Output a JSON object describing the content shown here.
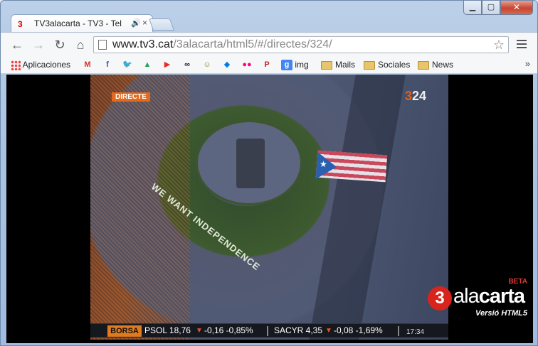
{
  "window": {
    "controls": {
      "minimize": "▁",
      "maximize": "▢",
      "close": "✕"
    }
  },
  "tab": {
    "favicon": "3",
    "title": "TV3alacarta - TV3 - Tel",
    "audio_icon": "speaker-icon",
    "audio_glyph": "🔊",
    "close_glyph": "×"
  },
  "toolbar": {
    "back": "←",
    "forward": "→",
    "reload": "↻",
    "home": "⌂",
    "url_host": "www.tv3.cat",
    "url_rest": "/3alacarta/html5/#/directes/324/",
    "star": "☆"
  },
  "bookmarks": {
    "apps_label": "Aplicaciones",
    "items": [
      {
        "icon": "gmail-icon",
        "glyph": "M",
        "color": "#d93025"
      },
      {
        "icon": "facebook-icon",
        "glyph": "f",
        "color": "#3b5998"
      },
      {
        "icon": "twitter-icon",
        "glyph": "🐦",
        "color": "#1da1f2"
      },
      {
        "icon": "drive-icon",
        "glyph": "▲",
        "color": "#1ea362"
      },
      {
        "icon": "youtube-icon",
        "glyph": "▶",
        "color": "#e52d27"
      },
      {
        "icon": "infinity-icon",
        "glyph": "∞",
        "color": "#222222"
      },
      {
        "icon": "smiley-icon",
        "glyph": "☺",
        "color": "#8a8a30"
      },
      {
        "icon": "dropbox-icon",
        "glyph": "◆",
        "color": "#007ee5"
      },
      {
        "icon": "flickr-icon",
        "glyph": "●●",
        "color": "#ff0084"
      },
      {
        "icon": "pinterest-icon",
        "glyph": "P",
        "color": "#cb2027"
      },
      {
        "icon": "google-icon",
        "glyph": "g",
        "color": "#4285f4"
      }
    ],
    "img_label": "img",
    "folders": [
      "Mails",
      "Sociales",
      "News"
    ],
    "more": "»"
  },
  "video": {
    "directe_badge": "DIRECTE",
    "channel_logo_a": "3",
    "channel_logo_b": "24",
    "banner_text": "WE WANT INDEPENDENCE",
    "ticker": {
      "label": "BORSA",
      "items": [
        {
          "text": "PSOL 18,76"
        },
        {
          "text": "-0,16  -0,85%"
        },
        {
          "text": "SACYR 4,35"
        },
        {
          "text": "-0,08  -1,69%"
        }
      ],
      "time": "17:34"
    }
  },
  "brand": {
    "beta": "BETA",
    "logo_glyph": "3",
    "name_a": "ala",
    "name_b": "carta",
    "subtitle": "Versió  HTML5"
  }
}
